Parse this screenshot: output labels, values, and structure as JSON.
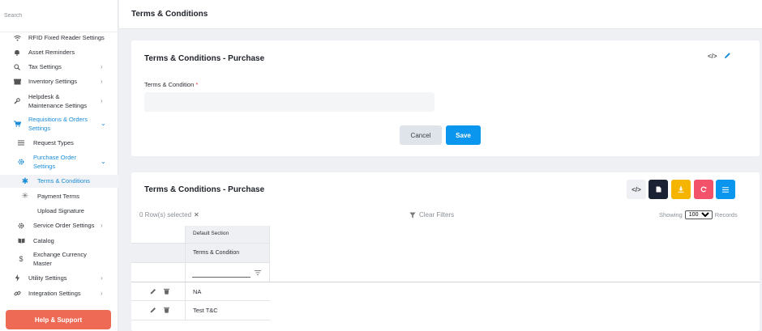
{
  "sidebar": {
    "search_placeholder": "Search",
    "items": [
      {
        "label": "RFID Fixed Reader Settings",
        "icon": "wifi-icon"
      },
      {
        "label": "Asset Reminders",
        "icon": "bell-icon"
      },
      {
        "label": "Tax Settings",
        "icon": "percent-search-icon"
      },
      {
        "label": "Inventory Settings",
        "icon": "box-icon"
      },
      {
        "label": "Helpdesk &",
        "label2": "Maintenance Settings",
        "icon": "wrench-icon"
      },
      {
        "label": "Requisitions & Orders",
        "label2": "Settings",
        "icon": "cart-icon"
      },
      {
        "label": "Request Types",
        "icon": "list-icon"
      },
      {
        "label": "Purchase Order",
        "label2": "Settings",
        "icon": "gear-icon"
      },
      {
        "label": "Terms & Conditions",
        "icon": "asterisk-icon"
      },
      {
        "label": "Payment Terms",
        "icon": "asterisk-icon"
      },
      {
        "label": "Upload Signature"
      },
      {
        "label": "Service Order Settings",
        "icon": "gear-icon"
      },
      {
        "label": "Catalog",
        "icon": "book-icon"
      },
      {
        "label": "Exchange Currency",
        "label2": "Master",
        "icon": "dollar-icon"
      },
      {
        "label": "Utility Settings",
        "icon": "bolt-icon"
      },
      {
        "label": "Integration Settings",
        "icon": "link-icon"
      }
    ],
    "help_label": "Help & Support"
  },
  "header": {
    "title": "Terms & Conditions"
  },
  "form": {
    "title": "Terms & Conditions - Purchase",
    "field_label": "Terms & Condition",
    "required_mark": "*",
    "field_value": "",
    "cancel_label": "Cancel",
    "save_label": "Save"
  },
  "table": {
    "title": "Terms & Conditions - Purchase",
    "rows_selected": "0 Row(s) selected",
    "clear_filters": "Clear Filters",
    "showing_label": "Showing",
    "page_size": "100",
    "page_size_options": [
      "100"
    ],
    "records_label": "Records",
    "group_header": "Default Section",
    "column_header": "Terms & Condition",
    "rows": [
      "NA",
      "Test T&C"
    ]
  },
  "colors": {
    "accent": "#0a95ef",
    "active_nav": "#1a8cd8",
    "help": "#ef6a55",
    "download": "#f5b400",
    "refresh": "#f2536b",
    "doc": "#1b2233"
  }
}
